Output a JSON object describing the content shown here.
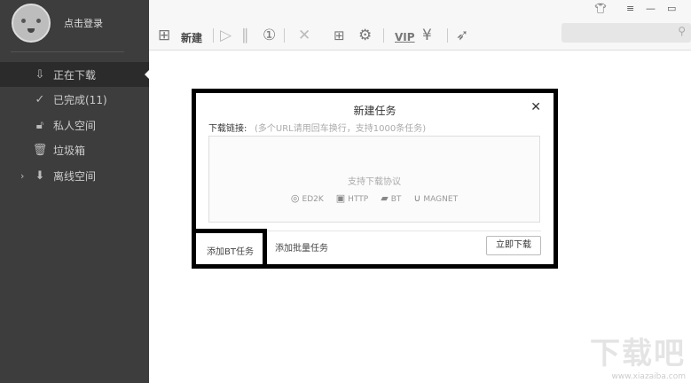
{
  "sidebar": {
    "login": "点击登录",
    "items": [
      {
        "icon": "download-icon",
        "glyph": "⇩",
        "label": "正在下载"
      },
      {
        "icon": "check-circle-icon",
        "glyph": "✓",
        "label": "已完成(11)"
      },
      {
        "icon": "lock-icon",
        "glyph": "🔓︎",
        "label": "私人空间"
      },
      {
        "icon": "trash-icon",
        "glyph": "🗑︎",
        "label": "垃圾箱"
      },
      {
        "icon": "cloud-download-icon",
        "glyph": "⬇",
        "label": "离线空间"
      }
    ]
  },
  "toolbar": {
    "new_label": "新建",
    "vip": "VIP"
  },
  "dialog": {
    "title": "新建任务",
    "link_label": "下载链接:",
    "hint": "(多个URL请用回车换行，支持1000条任务)",
    "protocols_title": "支持下载协议",
    "protocols": [
      "ED2K",
      "HTTP",
      "BT",
      "MAGNET"
    ],
    "add_bt": "添加BT任务",
    "add_batch": "添加批量任务",
    "download_now": "立即下载"
  },
  "watermark": {
    "text": "下载吧",
    "url": "www.xiazaiba.com"
  }
}
